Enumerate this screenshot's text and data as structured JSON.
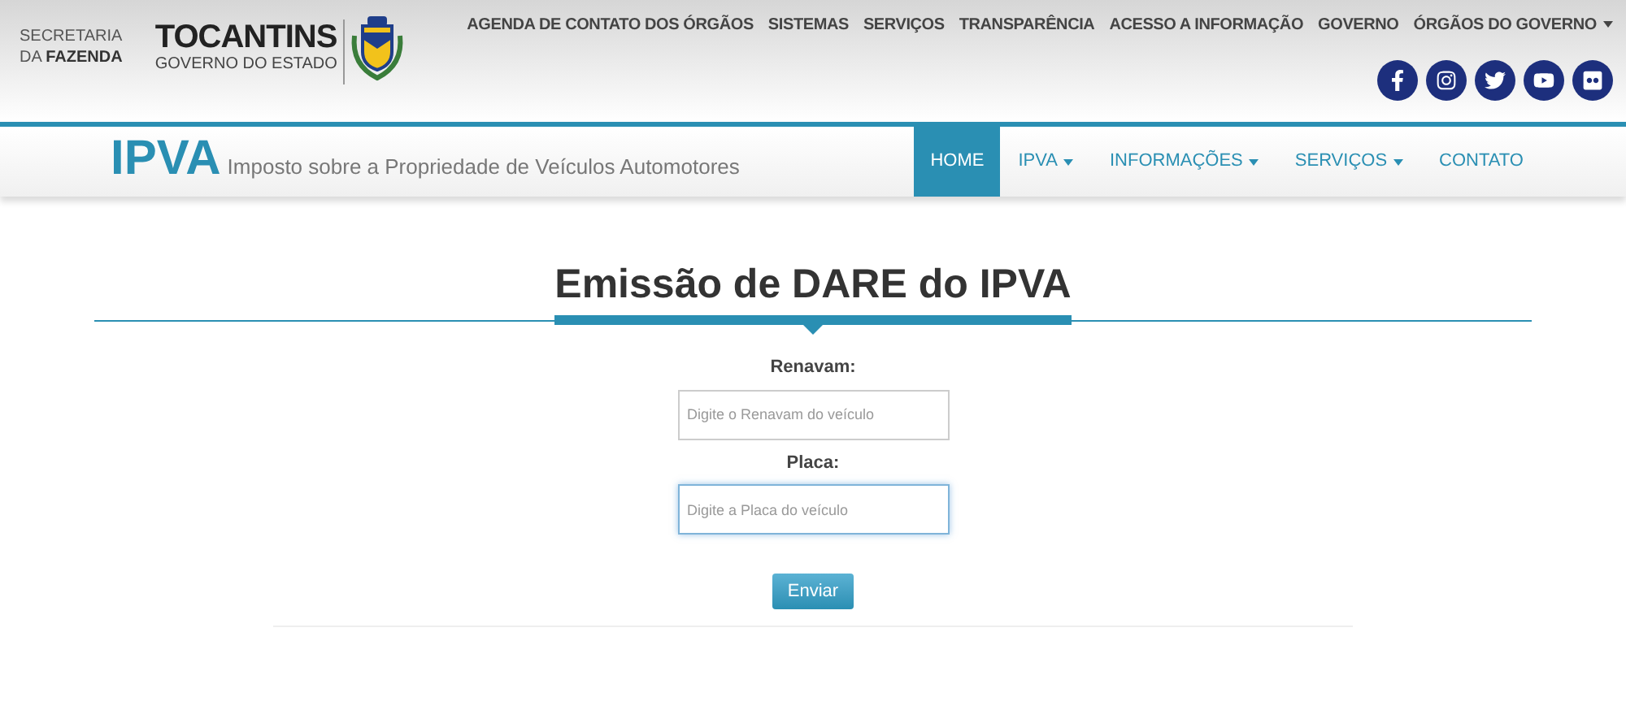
{
  "header": {
    "secretaria": {
      "line_1": "SECRETARIA",
      "line_2_prefix": "DA",
      "line_2_bold": "FAZENDA"
    },
    "brand": {
      "title": "TOCANTINS",
      "subtitle": "GOVERNO DO ESTADO"
    },
    "top_menu": [
      {
        "label": "AGENDA DE CONTATO DOS ÓRGÃOS",
        "has_dropdown": false
      },
      {
        "label": "SISTEMAS",
        "has_dropdown": false
      },
      {
        "label": "SERVIÇOS",
        "has_dropdown": false
      },
      {
        "label": "TRANSPARÊNCIA",
        "has_dropdown": false
      },
      {
        "label": "ACESSO A INFORMAÇÃO",
        "has_dropdown": false
      },
      {
        "label": "GOVERNO",
        "has_dropdown": false
      },
      {
        "label": "ÓRGÃOS DO GOVERNO",
        "has_dropdown": true
      }
    ],
    "social": [
      {
        "kind": "facebook"
      },
      {
        "kind": "instagram"
      },
      {
        "kind": "twitter"
      },
      {
        "kind": "youtube"
      },
      {
        "kind": "flickr"
      }
    ]
  },
  "navbar": {
    "logo": "IPVA",
    "tagline": "Imposto sobre a Propriedade de Veículos Automotores",
    "items": [
      {
        "label": "HOME",
        "selected": true,
        "has_dropdown": false
      },
      {
        "label": "IPVA",
        "selected": false,
        "has_dropdown": true
      },
      {
        "label": "INFORMAÇÕES",
        "selected": false,
        "has_dropdown": true
      },
      {
        "label": "SERVIÇOS",
        "selected": false,
        "has_dropdown": true
      },
      {
        "label": "CONTATO",
        "selected": false,
        "has_dropdown": false
      }
    ]
  },
  "form": {
    "title": "Emissão de DARE do IPVA",
    "fields": [
      {
        "label": "Renavam:",
        "placeholder": "Digite o Renavam do veículo",
        "focused": false
      },
      {
        "label": "Placa:",
        "placeholder": "Digite a Placa do veículo",
        "focused": true
      }
    ],
    "submit": "Enviar"
  }
}
